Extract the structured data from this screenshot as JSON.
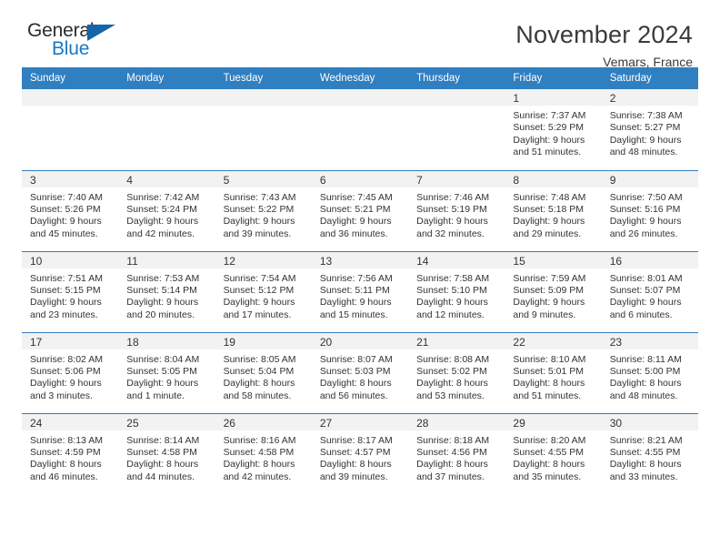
{
  "logo": {
    "word_one": "General",
    "word_two": "Blue",
    "triangle": "blue-triangle-icon"
  },
  "header": {
    "title": "November 2024",
    "subtitle": "Vemars, France"
  },
  "colors": {
    "header_blue": "#2f7fc1",
    "logo_blue": "#1878c4",
    "daynum_bg": "#f2f2f2",
    "text": "#333333"
  },
  "weekday_headers": [
    "Sunday",
    "Monday",
    "Tuesday",
    "Wednesday",
    "Thursday",
    "Friday",
    "Saturday"
  ],
  "labels": {
    "sunrise_prefix": "Sunrise:",
    "sunset_prefix": "Sunset:",
    "daylight_prefix": "Daylight:"
  },
  "weeks": [
    [
      {
        "day": "",
        "sunrise": "",
        "sunset": "",
        "daylight_line1": "",
        "daylight_line2": "",
        "empty": true
      },
      {
        "day": "",
        "sunrise": "",
        "sunset": "",
        "daylight_line1": "",
        "daylight_line2": "",
        "empty": true
      },
      {
        "day": "",
        "sunrise": "",
        "sunset": "",
        "daylight_line1": "",
        "daylight_line2": "",
        "empty": true
      },
      {
        "day": "",
        "sunrise": "",
        "sunset": "",
        "daylight_line1": "",
        "daylight_line2": "",
        "empty": true
      },
      {
        "day": "",
        "sunrise": "",
        "sunset": "",
        "daylight_line1": "",
        "daylight_line2": "",
        "empty": true
      },
      {
        "day": "1",
        "sunrise": "Sunrise: 7:37 AM",
        "sunset": "Sunset: 5:29 PM",
        "daylight_line1": "Daylight: 9 hours",
        "daylight_line2": "and 51 minutes.",
        "empty": false
      },
      {
        "day": "2",
        "sunrise": "Sunrise: 7:38 AM",
        "sunset": "Sunset: 5:27 PM",
        "daylight_line1": "Daylight: 9 hours",
        "daylight_line2": "and 48 minutes.",
        "empty": false
      }
    ],
    [
      {
        "day": "3",
        "sunrise": "Sunrise: 7:40 AM",
        "sunset": "Sunset: 5:26 PM",
        "daylight_line1": "Daylight: 9 hours",
        "daylight_line2": "and 45 minutes.",
        "empty": false
      },
      {
        "day": "4",
        "sunrise": "Sunrise: 7:42 AM",
        "sunset": "Sunset: 5:24 PM",
        "daylight_line1": "Daylight: 9 hours",
        "daylight_line2": "and 42 minutes.",
        "empty": false
      },
      {
        "day": "5",
        "sunrise": "Sunrise: 7:43 AM",
        "sunset": "Sunset: 5:22 PM",
        "daylight_line1": "Daylight: 9 hours",
        "daylight_line2": "and 39 minutes.",
        "empty": false
      },
      {
        "day": "6",
        "sunrise": "Sunrise: 7:45 AM",
        "sunset": "Sunset: 5:21 PM",
        "daylight_line1": "Daylight: 9 hours",
        "daylight_line2": "and 36 minutes.",
        "empty": false
      },
      {
        "day": "7",
        "sunrise": "Sunrise: 7:46 AM",
        "sunset": "Sunset: 5:19 PM",
        "daylight_line1": "Daylight: 9 hours",
        "daylight_line2": "and 32 minutes.",
        "empty": false
      },
      {
        "day": "8",
        "sunrise": "Sunrise: 7:48 AM",
        "sunset": "Sunset: 5:18 PM",
        "daylight_line1": "Daylight: 9 hours",
        "daylight_line2": "and 29 minutes.",
        "empty": false
      },
      {
        "day": "9",
        "sunrise": "Sunrise: 7:50 AM",
        "sunset": "Sunset: 5:16 PM",
        "daylight_line1": "Daylight: 9 hours",
        "daylight_line2": "and 26 minutes.",
        "empty": false
      }
    ],
    [
      {
        "day": "10",
        "sunrise": "Sunrise: 7:51 AM",
        "sunset": "Sunset: 5:15 PM",
        "daylight_line1": "Daylight: 9 hours",
        "daylight_line2": "and 23 minutes.",
        "empty": false
      },
      {
        "day": "11",
        "sunrise": "Sunrise: 7:53 AM",
        "sunset": "Sunset: 5:14 PM",
        "daylight_line1": "Daylight: 9 hours",
        "daylight_line2": "and 20 minutes.",
        "empty": false
      },
      {
        "day": "12",
        "sunrise": "Sunrise: 7:54 AM",
        "sunset": "Sunset: 5:12 PM",
        "daylight_line1": "Daylight: 9 hours",
        "daylight_line2": "and 17 minutes.",
        "empty": false
      },
      {
        "day": "13",
        "sunrise": "Sunrise: 7:56 AM",
        "sunset": "Sunset: 5:11 PM",
        "daylight_line1": "Daylight: 9 hours",
        "daylight_line2": "and 15 minutes.",
        "empty": false
      },
      {
        "day": "14",
        "sunrise": "Sunrise: 7:58 AM",
        "sunset": "Sunset: 5:10 PM",
        "daylight_line1": "Daylight: 9 hours",
        "daylight_line2": "and 12 minutes.",
        "empty": false
      },
      {
        "day": "15",
        "sunrise": "Sunrise: 7:59 AM",
        "sunset": "Sunset: 5:09 PM",
        "daylight_line1": "Daylight: 9 hours",
        "daylight_line2": "and 9 minutes.",
        "empty": false
      },
      {
        "day": "16",
        "sunrise": "Sunrise: 8:01 AM",
        "sunset": "Sunset: 5:07 PM",
        "daylight_line1": "Daylight: 9 hours",
        "daylight_line2": "and 6 minutes.",
        "empty": false
      }
    ],
    [
      {
        "day": "17",
        "sunrise": "Sunrise: 8:02 AM",
        "sunset": "Sunset: 5:06 PM",
        "daylight_line1": "Daylight: 9 hours",
        "daylight_line2": "and 3 minutes.",
        "empty": false
      },
      {
        "day": "18",
        "sunrise": "Sunrise: 8:04 AM",
        "sunset": "Sunset: 5:05 PM",
        "daylight_line1": "Daylight: 9 hours",
        "daylight_line2": "and 1 minute.",
        "empty": false
      },
      {
        "day": "19",
        "sunrise": "Sunrise: 8:05 AM",
        "sunset": "Sunset: 5:04 PM",
        "daylight_line1": "Daylight: 8 hours",
        "daylight_line2": "and 58 minutes.",
        "empty": false
      },
      {
        "day": "20",
        "sunrise": "Sunrise: 8:07 AM",
        "sunset": "Sunset: 5:03 PM",
        "daylight_line1": "Daylight: 8 hours",
        "daylight_line2": "and 56 minutes.",
        "empty": false
      },
      {
        "day": "21",
        "sunrise": "Sunrise: 8:08 AM",
        "sunset": "Sunset: 5:02 PM",
        "daylight_line1": "Daylight: 8 hours",
        "daylight_line2": "and 53 minutes.",
        "empty": false
      },
      {
        "day": "22",
        "sunrise": "Sunrise: 8:10 AM",
        "sunset": "Sunset: 5:01 PM",
        "daylight_line1": "Daylight: 8 hours",
        "daylight_line2": "and 51 minutes.",
        "empty": false
      },
      {
        "day": "23",
        "sunrise": "Sunrise: 8:11 AM",
        "sunset": "Sunset: 5:00 PM",
        "daylight_line1": "Daylight: 8 hours",
        "daylight_line2": "and 48 minutes.",
        "empty": false
      }
    ],
    [
      {
        "day": "24",
        "sunrise": "Sunrise: 8:13 AM",
        "sunset": "Sunset: 4:59 PM",
        "daylight_line1": "Daylight: 8 hours",
        "daylight_line2": "and 46 minutes.",
        "empty": false
      },
      {
        "day": "25",
        "sunrise": "Sunrise: 8:14 AM",
        "sunset": "Sunset: 4:58 PM",
        "daylight_line1": "Daylight: 8 hours",
        "daylight_line2": "and 44 minutes.",
        "empty": false
      },
      {
        "day": "26",
        "sunrise": "Sunrise: 8:16 AM",
        "sunset": "Sunset: 4:58 PM",
        "daylight_line1": "Daylight: 8 hours",
        "daylight_line2": "and 42 minutes.",
        "empty": false
      },
      {
        "day": "27",
        "sunrise": "Sunrise: 8:17 AM",
        "sunset": "Sunset: 4:57 PM",
        "daylight_line1": "Daylight: 8 hours",
        "daylight_line2": "and 39 minutes.",
        "empty": false
      },
      {
        "day": "28",
        "sunrise": "Sunrise: 8:18 AM",
        "sunset": "Sunset: 4:56 PM",
        "daylight_line1": "Daylight: 8 hours",
        "daylight_line2": "and 37 minutes.",
        "empty": false
      },
      {
        "day": "29",
        "sunrise": "Sunrise: 8:20 AM",
        "sunset": "Sunset: 4:55 PM",
        "daylight_line1": "Daylight: 8 hours",
        "daylight_line2": "and 35 minutes.",
        "empty": false
      },
      {
        "day": "30",
        "sunrise": "Sunrise: 8:21 AM",
        "sunset": "Sunset: 4:55 PM",
        "daylight_line1": "Daylight: 8 hours",
        "daylight_line2": "and 33 minutes.",
        "empty": false
      }
    ]
  ]
}
